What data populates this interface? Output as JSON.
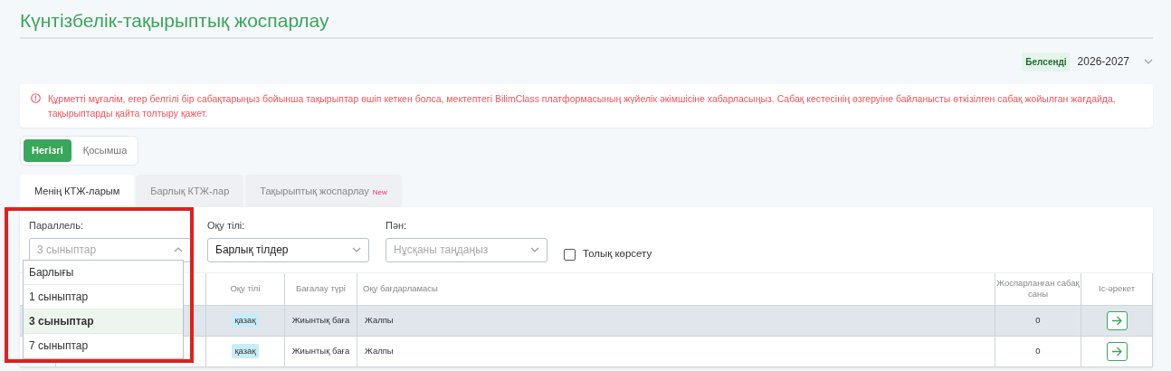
{
  "page_title": "Күнтізбелік-тақырыптық жоспарлау",
  "year_selector": {
    "status": "Белсенді",
    "year": "2026-2027"
  },
  "alert": "Құрметті мұғалім, егер белгілі бір сабақтарыңыз бойынша тақырыптар өшіп кеткен болса, мектептегі BilimClass платформасының жүйелік әкімшісіне хабарласыңыз. Сабақ кестесінің өзгеруіне байланысты өткізілген сабақ жойылған жағдайда, тақырыптарды қайта толтыру қажет.",
  "segments": [
    {
      "label": "Негізгі",
      "selected": true
    },
    {
      "label": "Қосымша",
      "selected": false
    }
  ],
  "tabs": [
    {
      "label": "Менің КТЖ-ларым",
      "selected": true
    },
    {
      "label": "Барлық КТЖ-лар",
      "selected": false
    },
    {
      "label": "Тақырыптық жоспарлау",
      "selected": false,
      "badge": "New"
    }
  ],
  "filters": [
    {
      "label": "Параллель:",
      "value": "3 сыныптар",
      "expanded": true,
      "options": [
        {
          "label": "Барлығы",
          "selected": false
        },
        {
          "label": "1 сыныптар",
          "selected": false
        },
        {
          "label": "3 сыныптар",
          "selected": true
        },
        {
          "label": "7 сыныптар",
          "selected": false
        }
      ]
    },
    {
      "label": "Оқу тілі:",
      "value": "Барлық тілдер",
      "expanded": false
    },
    {
      "label": "Пән:",
      "placeholder": "Нұсқаны таңдаңыз",
      "expanded": false
    }
  ],
  "full_view": {
    "label": "Толық көрсету",
    "checked": false
  },
  "table": {
    "columns": [
      "Оқу тілі",
      "Бағалау түрі",
      "Оқу бағдарламасы",
      "Жоспарланған сабақ саны",
      "Іс-әрекет"
    ],
    "rows": [
      {
        "highlighted": true,
        "language": "қазақ",
        "assessment": "Жиынтық баға",
        "program": "Жалпы",
        "planned": "0"
      },
      {
        "highlighted": false,
        "language": "қазақ",
        "assessment": "Жиынтық баға",
        "program": "Жалпы",
        "planned": "0"
      }
    ]
  }
}
